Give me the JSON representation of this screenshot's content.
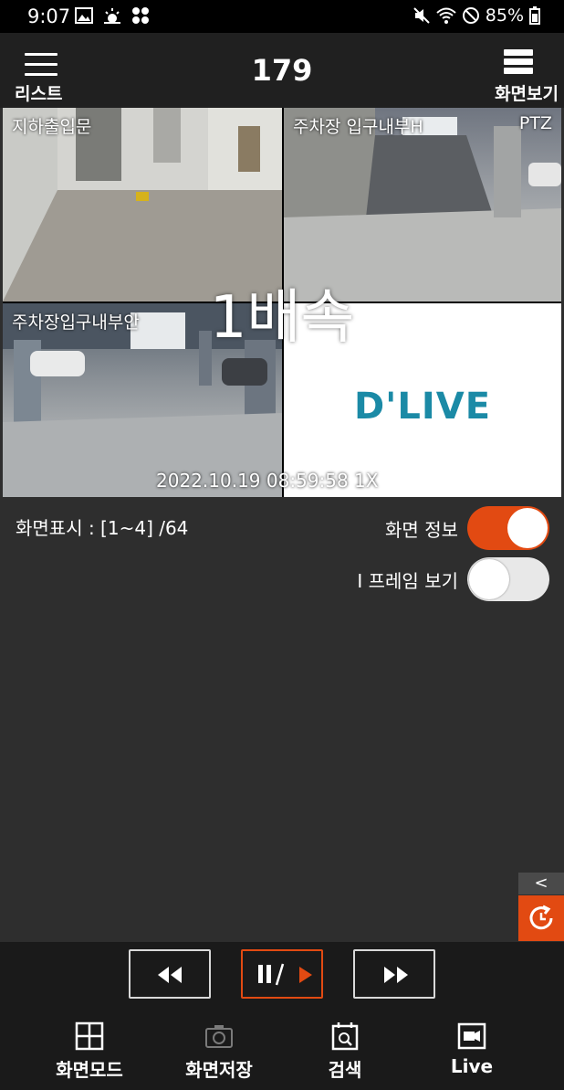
{
  "status_bar": {
    "time": "9:07",
    "battery": "85%"
  },
  "header": {
    "menu_label": "리스트",
    "title": "179",
    "view_label": "화면보기"
  },
  "cameras": [
    {
      "label": "지하출입문",
      "badge": ""
    },
    {
      "label": "주차장 입구내부H",
      "badge": "PTZ"
    },
    {
      "label": "주차장입구내부안",
      "badge": ""
    },
    {
      "label": "",
      "badge": ""
    }
  ],
  "overlay": {
    "speed": "1배속",
    "timestamp": "2022.10.19  08:59:58        1X"
  },
  "logo_text": "D'LIVE",
  "display_info": "화면표시 : [1~4] /64",
  "toggles": [
    {
      "label": "화면 정보",
      "on": true
    },
    {
      "label": "I 프레임 보기",
      "on": false
    }
  ],
  "side_tab": "<",
  "bottom_nav": [
    {
      "label": "화면모드",
      "icon": "grid-icon"
    },
    {
      "label": "화면저장",
      "icon": "camera-icon"
    },
    {
      "label": "검색",
      "icon": "calendar-search-icon"
    },
    {
      "label": "Live",
      "icon": "video-icon"
    }
  ],
  "colors": {
    "accent": "#e24a12",
    "header_bg": "#202020",
    "body_bg": "#2e2e2e",
    "bottom_bg": "#1a1a1a",
    "logo": "#1b8aa6"
  }
}
